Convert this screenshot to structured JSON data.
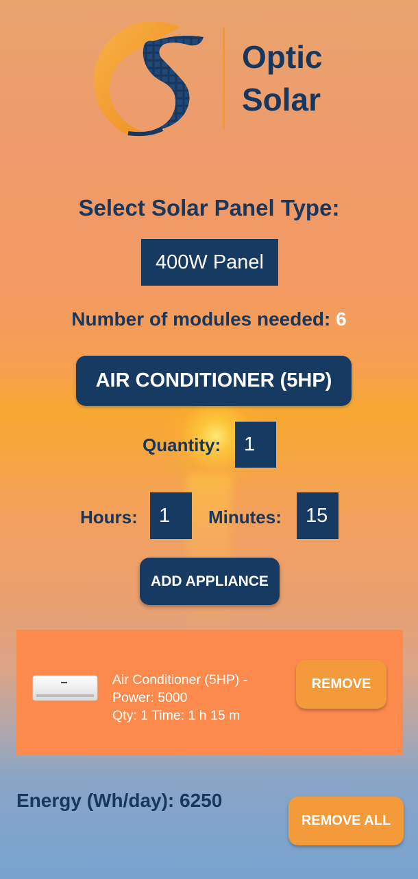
{
  "brand": {
    "line1": "Optic",
    "line2": "Solar"
  },
  "panel_selector": {
    "heading": "Select Solar Panel Type:",
    "selected": "400W Panel"
  },
  "modules": {
    "label": "Number of modules needed:",
    "count": "6"
  },
  "appliance_selector": {
    "selected": "AIR CONDITIONER (5HP)"
  },
  "quantity": {
    "label": "Quantity:",
    "value": "1"
  },
  "duration": {
    "hours_label": "Hours:",
    "hours_value": "1",
    "minutes_label": "Minutes:",
    "minutes_value": "15"
  },
  "actions": {
    "add_label": "ADD APPLIANCE",
    "remove_all_label": "REMOVE ALL"
  },
  "appliances": [
    {
      "line1": "Air Conditioner (5HP) -",
      "line2": "Power: 5000",
      "line3": "Qty: 1 Time: 1 h 15 m",
      "remove_label": "REMOVE",
      "icon": "air-conditioner-icon"
    }
  ],
  "energy": {
    "label": "Energy (Wh/day):",
    "value": "6250"
  },
  "colors": {
    "navy": "#173a63",
    "text_navy": "#17375e",
    "accent_orange": "#f39a3a",
    "card_orange": "#fd8a4d"
  }
}
